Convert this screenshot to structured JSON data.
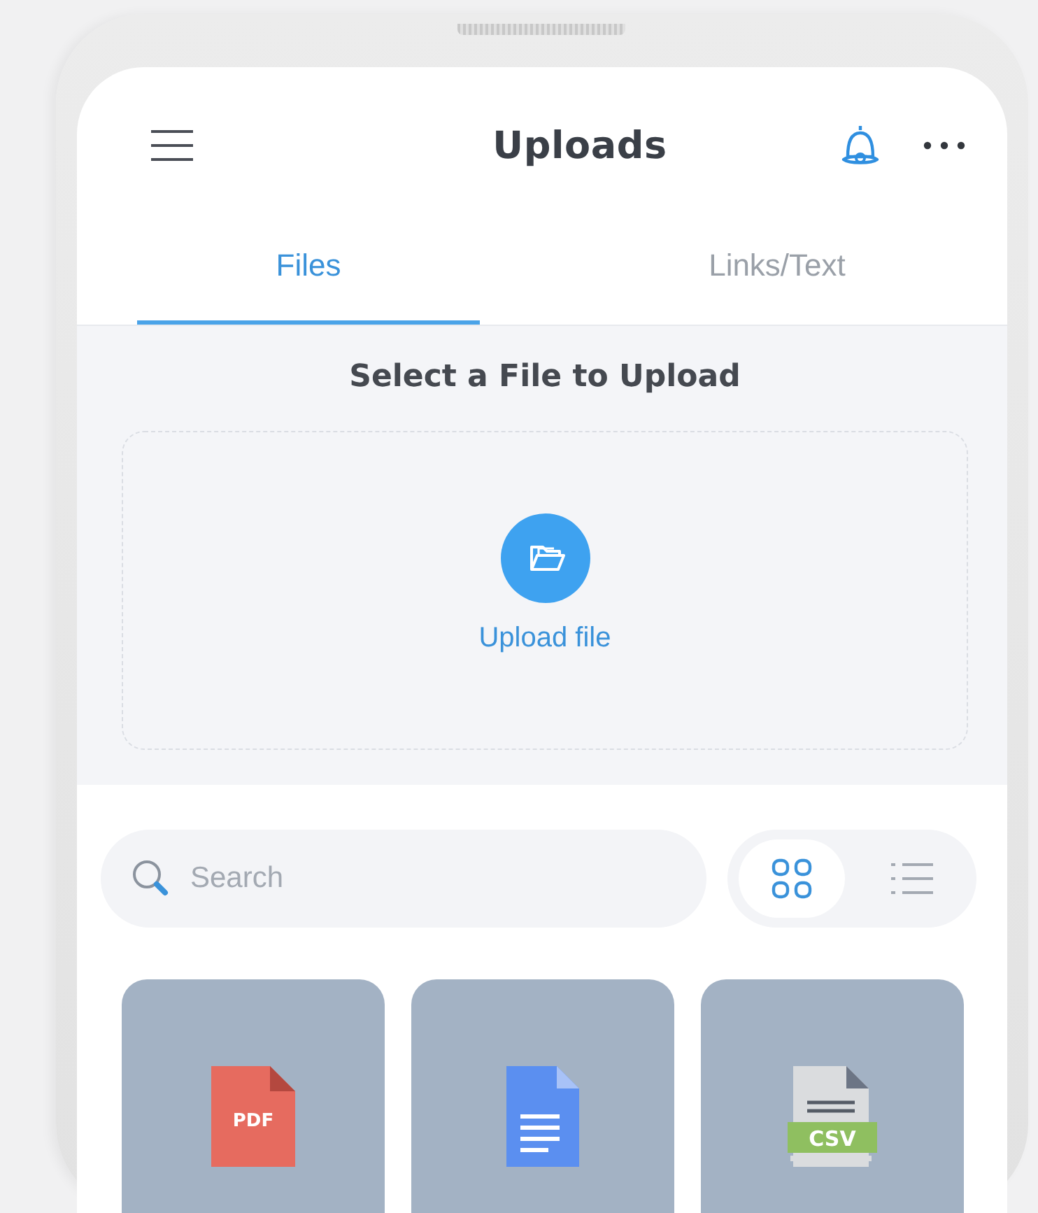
{
  "header": {
    "title": "Uploads"
  },
  "tabs": [
    {
      "label": "Files",
      "selected": true
    },
    {
      "label": "Links/Text",
      "selected": false
    }
  ],
  "upload": {
    "title": "Select a File to Upload",
    "action": "Upload file"
  },
  "search": {
    "placeholder": "Search"
  },
  "view_modes": [
    {
      "kind": "grid",
      "selected": true
    },
    {
      "kind": "list",
      "selected": false
    }
  ],
  "files": [
    {
      "kind": "pdf",
      "badge": "PDF"
    },
    {
      "kind": "doc"
    },
    {
      "kind": "csv",
      "badge": "CSV"
    }
  ]
}
